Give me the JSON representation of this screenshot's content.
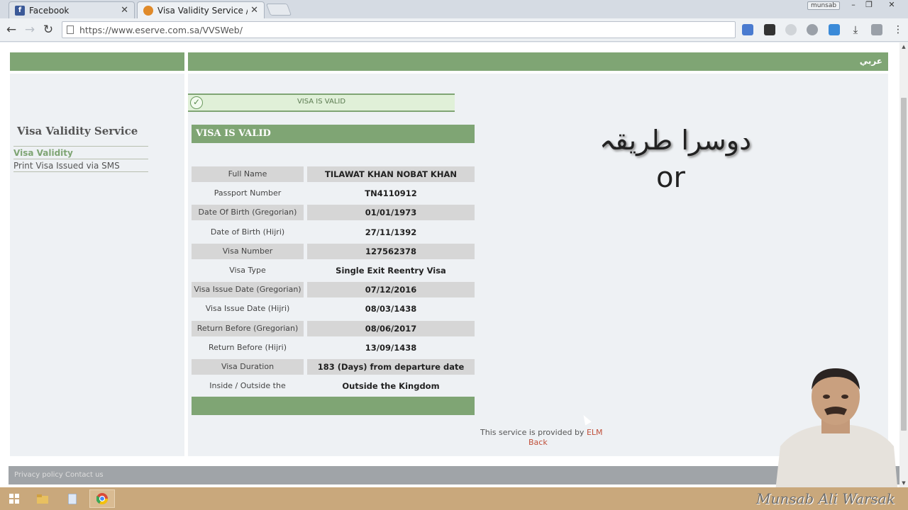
{
  "browser": {
    "tabs": [
      {
        "title": "Facebook",
        "close": "✕"
      },
      {
        "title": "Visa Validity Service / برة",
        "close": "✕"
      }
    ],
    "profile_badge": "munsab",
    "url": "https://www.eserve.com.sa/VVSWeb/"
  },
  "header": {
    "arabic_link": "عربي"
  },
  "sidebar": {
    "title": "Visa Validity Service",
    "items": [
      {
        "label": "Visa Validity",
        "active": true
      },
      {
        "label": "Print Visa Issued via SMS",
        "active": false
      }
    ]
  },
  "status_banner": "VISA IS VALID",
  "visa_heading": "VISA IS VALID",
  "visa_rows": [
    {
      "label": "Full Name",
      "value": "TILAWAT KHAN NOBAT KHAN"
    },
    {
      "label": "Passport Number",
      "value": "TN4110912"
    },
    {
      "label": "Date Of Birth (Gregorian)",
      "value": "01/01/1973"
    },
    {
      "label": "Date of Birth (Hijri)",
      "value": "27/11/1392"
    },
    {
      "label": "Visa Number",
      "value": "127562378"
    },
    {
      "label": "Visa Type",
      "value": "Single Exit Reentry Visa"
    },
    {
      "label": "Visa Issue Date (Gregorian)",
      "value": "07/12/2016"
    },
    {
      "label": "Visa Issue Date (Hijri)",
      "value": "08/03/1438"
    },
    {
      "label": "Return Before (Gregorian)",
      "value": "08/06/2017"
    },
    {
      "label": "Return Before (Hijri)",
      "value": "13/09/1438"
    },
    {
      "label": "Visa Duration",
      "value": "183 (Days) from departure date"
    },
    {
      "label": "Inside / Outside the Kingdom",
      "value": "Outside the Kingdom"
    }
  ],
  "provided_by": {
    "text": "This service is provided by",
    "link": "ELM"
  },
  "back_link": "Back",
  "overlay": {
    "urdu": "دوسرا طریقہ",
    "or": "or"
  },
  "footer_links": [
    "Privacy policy",
    "Contact us"
  ],
  "watermark": "Munsab Ali Warsak",
  "colors": {
    "accent": "#7fa574",
    "banner_bg": "#e0f0d8",
    "link": "#c0503a"
  }
}
